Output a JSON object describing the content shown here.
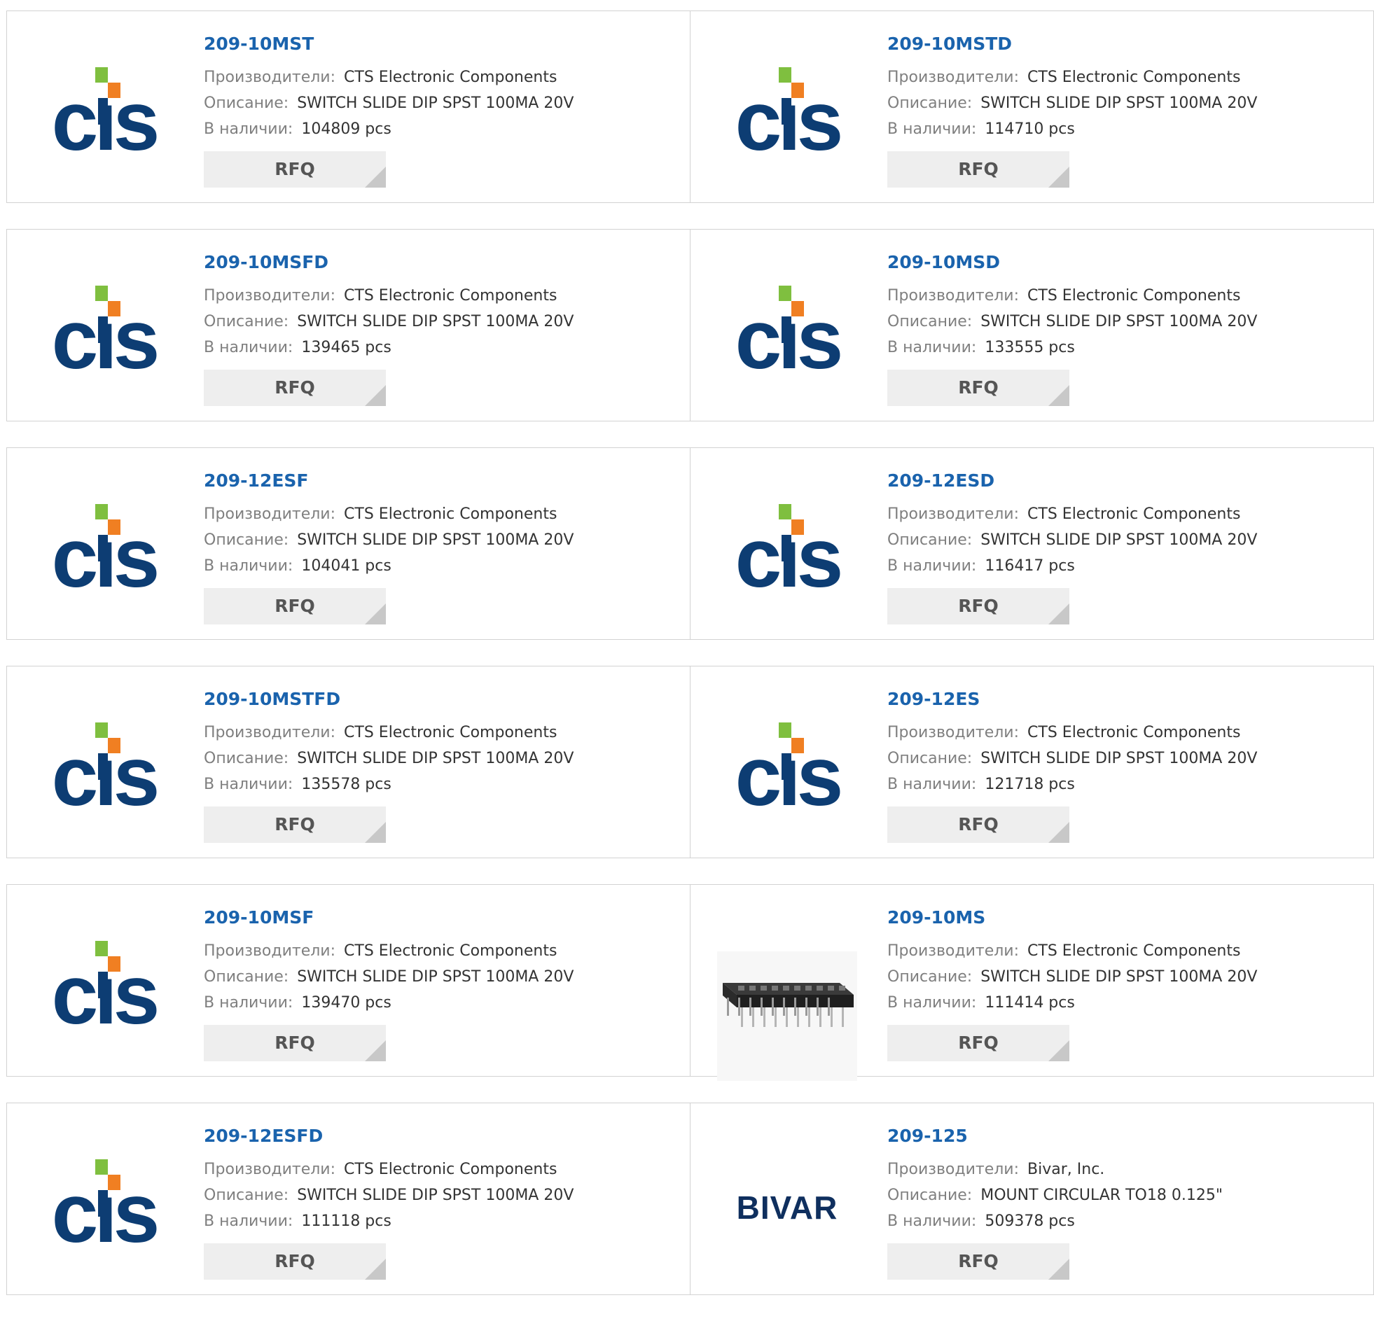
{
  "labels": {
    "manufacturer": "Производители:",
    "description": "Описание:",
    "stock": "В наличии:",
    "rfq": "RFQ"
  },
  "colors": {
    "part_link": "#1a63ad",
    "cts_blue": "#0d3d73",
    "cts_green": "#7fbf3f",
    "cts_orange": "#f07f22",
    "bivar": "#0f2f5e"
  },
  "products": [
    {
      "part": "209-10MST",
      "manufacturer": "CTS Electronic Components",
      "description": "SWITCH SLIDE DIP SPST 100MA 20V",
      "stock": "104809 pcs",
      "logo": "cts-logo"
    },
    {
      "part": "209-10MSTD",
      "manufacturer": "CTS Electronic Components",
      "description": "SWITCH SLIDE DIP SPST 100MA 20V",
      "stock": "114710 pcs",
      "logo": "cts-logo"
    },
    {
      "part": "209-10MSFD",
      "manufacturer": "CTS Electronic Components",
      "description": "SWITCH SLIDE DIP SPST 100MA 20V",
      "stock": "139465 pcs",
      "logo": "cts-logo"
    },
    {
      "part": "209-10MSD",
      "manufacturer": "CTS Electronic Components",
      "description": "SWITCH SLIDE DIP SPST 100MA 20V",
      "stock": "133555 pcs",
      "logo": "cts-logo"
    },
    {
      "part": "209-12ESF",
      "manufacturer": "CTS Electronic Components",
      "description": "SWITCH SLIDE DIP SPST 100MA 20V",
      "stock": "104041 pcs",
      "logo": "cts-logo"
    },
    {
      "part": "209-12ESD",
      "manufacturer": "CTS Electronic Components",
      "description": "SWITCH SLIDE DIP SPST 100MA 20V",
      "stock": "116417 pcs",
      "logo": "cts-logo"
    },
    {
      "part": "209-10MSTFD",
      "manufacturer": "CTS Electronic Components",
      "description": "SWITCH SLIDE DIP SPST 100MA 20V",
      "stock": "135578 pcs",
      "logo": "cts-logo"
    },
    {
      "part": "209-12ES",
      "manufacturer": "CTS Electronic Components",
      "description": "SWITCH SLIDE DIP SPST 100MA 20V",
      "stock": "121718 pcs",
      "logo": "cts-logo"
    },
    {
      "part": "209-10MSF",
      "manufacturer": "CTS Electronic Components",
      "description": "SWITCH SLIDE DIP SPST 100MA 20V",
      "stock": "139470 pcs",
      "logo": "cts-logo"
    },
    {
      "part": "209-10MS",
      "manufacturer": "CTS Electronic Components",
      "description": "SWITCH SLIDE DIP SPST 100MA 20V",
      "stock": "111414 pcs",
      "logo": "dip-switch-photo"
    },
    {
      "part": "209-12ESFD",
      "manufacturer": "CTS Electronic Components",
      "description": "SWITCH SLIDE DIP SPST 100MA 20V",
      "stock": "111118 pcs",
      "logo": "cts-logo"
    },
    {
      "part": "209-125",
      "manufacturer": "Bivar, Inc.",
      "description": "MOUNT CIRCULAR TO18 0.125\"",
      "stock": "509378 pcs",
      "logo": "bivar-logo"
    }
  ]
}
